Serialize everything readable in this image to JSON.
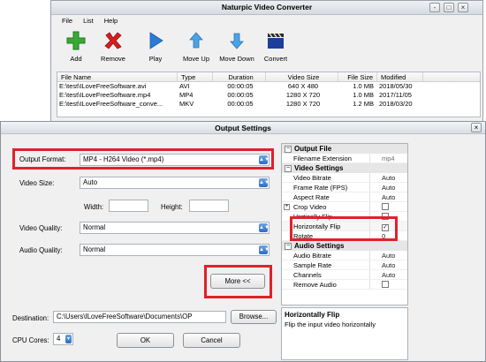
{
  "main_window": {
    "title": "Naturpic Video Converter",
    "controls": [
      "-",
      "□",
      "×"
    ],
    "menu": [
      "File",
      "List",
      "Help"
    ],
    "toolbar": [
      {
        "label": "Add",
        "icon": "add-icon",
        "color": "#39a935"
      },
      {
        "label": "Remove",
        "icon": "remove-icon",
        "color": "#d81e1e"
      },
      {
        "label": "Play",
        "icon": "play-icon",
        "color": "#2b7bd6"
      },
      {
        "label": "Move Up",
        "icon": "arrow-up-icon",
        "color": "#4aa3e6"
      },
      {
        "label": "Move Down",
        "icon": "arrow-down-icon",
        "color": "#4aa3e6"
      },
      {
        "label": "Convert",
        "icon": "clapperboard-icon",
        "color": "#1d3f9b"
      }
    ],
    "file_list": {
      "columns": [
        "File Name",
        "Type",
        "Duration",
        "Video Size",
        "File Size",
        "Modified"
      ],
      "rows": [
        [
          "E:\\test\\ILoveFreeSoftware.avi",
          "AVI",
          "00:00:05",
          "640 X 480",
          "1.0 MB",
          "2018/05/30"
        ],
        [
          "E:\\test\\ILoveFreeSoftware.mp4",
          "MP4",
          "00:00:05",
          "1280 X 720",
          "1.0 MB",
          "2017/11/05"
        ],
        [
          "E:\\test\\ILoveFreeSoftware_conve...",
          "MKV",
          "00:00:05",
          "1280 X 720",
          "1.2 MB",
          "2018/03/20"
        ]
      ]
    }
  },
  "dialog": {
    "title": "Output Settings",
    "close": "×",
    "output_format_label": "Output Format:",
    "output_format_value": "MP4 - H264 Video (*.mp4)",
    "video_size_label": "Video Size:",
    "video_size_value": "Auto",
    "width_label": "Width:",
    "height_label": "Height:",
    "video_quality_label": "Video Quality:",
    "video_quality_value": "Normal",
    "audio_quality_label": "Audio Quality:",
    "audio_quality_value": "Normal",
    "more_button": "More <<",
    "destination_label": "Destination:",
    "destination_value": "C:\\Users\\ILoveFreeSoftware\\Documents\\OP",
    "browse_button": "Browse...",
    "cpu_cores_label": "CPU Cores:",
    "cpu_cores_value": "4",
    "ok_button": "OK",
    "cancel_button": "Cancel",
    "highlight_color": "#e0212b",
    "properties": {
      "output_file": {
        "title": "Output File",
        "rows": [
          {
            "key": "Filename Extension",
            "value": "mp4"
          }
        ]
      },
      "video_settings": {
        "title": "Video Settings",
        "rows": [
          {
            "key": "Video Bitrate",
            "value": "Auto"
          },
          {
            "key": "Frame Rate (FPS)",
            "value": "Auto"
          },
          {
            "key": "Aspect Rate",
            "value": "Auto"
          },
          {
            "key": "Crop Video",
            "checked": false
          },
          {
            "key": "Vertically Flip",
            "checked": false
          },
          {
            "key": "Horizontally Flip",
            "checked": true
          },
          {
            "key": "Rotate",
            "value": "0"
          }
        ]
      },
      "audio_settings": {
        "title": "Audio Settings",
        "rows": [
          {
            "key": "Audio Bitrate",
            "value": "Auto"
          },
          {
            "key": "Sample Rate",
            "value": "Auto"
          },
          {
            "key": "Channels",
            "value": "Auto"
          },
          {
            "key": "Remove Audio",
            "checked": false
          }
        ]
      }
    },
    "description": {
      "title": "Horizontally Flip",
      "text": "Flip the input video horizontally"
    }
  }
}
